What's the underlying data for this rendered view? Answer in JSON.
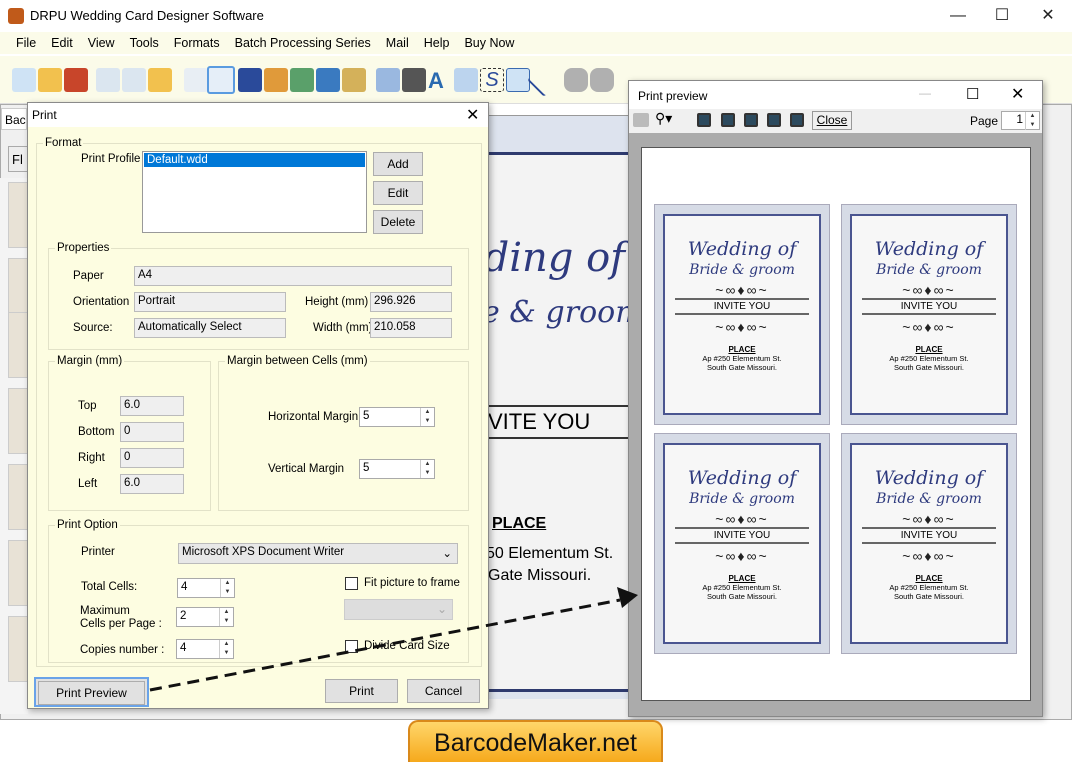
{
  "app": {
    "title": "DRPU Wedding Card Designer Software"
  },
  "menu": [
    "File",
    "Edit",
    "View",
    "Tools",
    "Formats",
    "Batch Processing Series",
    "Mail",
    "Help",
    "Buy Now"
  ],
  "left_panel": {
    "tab": "Bac",
    "button": "Fl"
  },
  "canvas": {
    "title1": "dding of",
    "title2": "e & groom",
    "invite": "VITE YOU",
    "place": "PLACE",
    "addr1": "50 Elementum St.",
    "addr2": "Gate Missouri."
  },
  "print_dialog": {
    "title": "Print",
    "format": {
      "legend": "Format",
      "profile_label": "Print Profile",
      "profiles": [
        "Default.wdd"
      ],
      "add": "Add",
      "edit": "Edit",
      "delete": "Delete"
    },
    "properties": {
      "legend": "Properties",
      "paper_label": "Paper",
      "paper": "A4",
      "orientation_label": "Orientation",
      "orientation": "Portrait",
      "source_label": "Source:",
      "source": "Automatically Select",
      "height_label": "Height (mm)",
      "height": "296.926",
      "width_label": "Width (mm)",
      "width": "210.058"
    },
    "margin": {
      "legend": "Margin (mm)",
      "top_label": "Top",
      "top": "6.0",
      "bottom_label": "Bottom",
      "bottom": "0",
      "right_label": "Right",
      "right": "0",
      "left_label": "Left",
      "left": "6.0"
    },
    "cell_margin": {
      "legend": "Margin between Cells (mm)",
      "h_label": "Horizontal Margin",
      "h": "5",
      "v_label": "Vertical Margin",
      "v": "5"
    },
    "print_option": {
      "legend": "Print Option",
      "printer_label": "Printer",
      "printer": "Microsoft XPS Document Writer",
      "total_label": "Total Cells:",
      "total": "4",
      "max_label1": "Maximum",
      "max_label2": "Cells per Page :",
      "max": "2",
      "copies_label": "Copies number :",
      "copies": "4",
      "fit_label": "Fit picture to frame",
      "fit_checked": false,
      "divide_label": "Divide Card Size",
      "divide_checked": false
    },
    "preview_btn": "Print Preview",
    "print_btn": "Print",
    "cancel_btn": "Cancel"
  },
  "preview": {
    "title": "Print preview",
    "close": "Close",
    "page_label": "Page",
    "page": "1",
    "card": {
      "title": "Wedding of",
      "subtitle": "Bride & groom",
      "invite": "INVITE YOU",
      "place": "PLACE",
      "addr1": "Ap #250 Elementum St.",
      "addr2": "South Gate Missouri."
    }
  },
  "watermark": "BarcodeMaker.net"
}
